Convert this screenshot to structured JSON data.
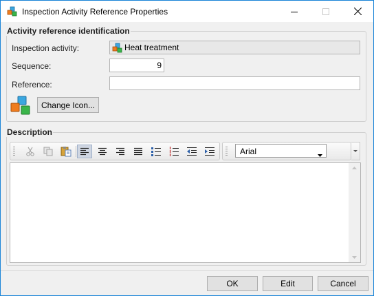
{
  "window": {
    "title": "Inspection Activity Reference Properties"
  },
  "identification": {
    "group_title": "Activity reference identification",
    "inspection_activity_label": "Inspection activity:",
    "inspection_activity_value": "Heat treatment",
    "sequence_label": "Sequence:",
    "sequence_value": "9",
    "reference_label": "Reference:",
    "reference_value": "",
    "change_icon_label": "Change Icon..."
  },
  "description": {
    "group_title": "Description",
    "font_value": "Arial",
    "text": ""
  },
  "footer": {
    "ok_label": "OK",
    "edit_label": "Edit",
    "cancel_label": "Cancel"
  },
  "colors": {
    "window_border": "#1883d7",
    "cube_orange": "#f07c1e",
    "cube_green": "#39b54a",
    "cube_blue": "#3aa7e0"
  }
}
